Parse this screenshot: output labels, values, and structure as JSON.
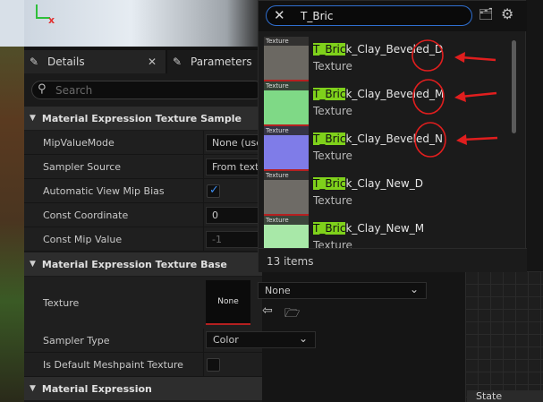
{
  "details_panel": {
    "tabs": [
      {
        "label": "Details",
        "icon": "pencil-icon"
      },
      {
        "label": "Parameters",
        "icon": "pencil-icon"
      }
    ],
    "search_placeholder": "Search",
    "categories": [
      "Material Expression Texture Sample",
      "Material Expression Texture Base",
      "Material Expression"
    ],
    "properties": [
      {
        "label": "MipValueMode",
        "value": "None (use"
      },
      {
        "label": "Sampler Source",
        "value": "From textu"
      },
      {
        "label": "Automatic View Mip Bias",
        "checked": true
      },
      {
        "label": "Const Coordinate",
        "value": "0"
      },
      {
        "label": "Const Mip Value",
        "value": "-1"
      }
    ],
    "texture": {
      "label": "Texture",
      "thumb_text": "None",
      "dropdown_value": "None"
    },
    "sampler_type": {
      "label": "Sampler Type",
      "value": "Color"
    },
    "meshpaint": {
      "label": "Is Default Meshpaint Texture",
      "checked": false
    }
  },
  "asset_picker": {
    "search_text": "T_Bric",
    "items": [
      {
        "thumb_label": "Texture",
        "name_highlight": "T_Bric",
        "name_rest": "k_Clay_Beveled_D",
        "type": "Texture",
        "thumb_color": "#6b6862"
      },
      {
        "thumb_label": "Texture",
        "name_highlight": "T_Bric",
        "name_rest": "k_Clay_Beveled_M",
        "type": "Texture",
        "thumb_color": "#7fd986"
      },
      {
        "thumb_label": "Texture",
        "name_highlight": "T_Bric",
        "name_rest": "k_Clay_Beveled_N",
        "type": "Texture",
        "thumb_color": "#7f7ce8"
      },
      {
        "thumb_label": "Texture",
        "name_highlight": "T_Bric",
        "name_rest": "k_Clay_New_D",
        "type": "Texture",
        "thumb_color": "#6e6b66"
      },
      {
        "thumb_label": "Texture",
        "name_highlight": "T_Bric",
        "name_rest": "k_Clay_New_M",
        "type": "Texture",
        "thumb_color": "#a8e8a8"
      }
    ],
    "count_text": "13 items"
  },
  "bottom_tab": {
    "label": "State"
  },
  "colors": {
    "accent_blue": "#2f6fd0",
    "highlight_green": "#7fd11b",
    "annotation_red": "#e01e1e"
  }
}
